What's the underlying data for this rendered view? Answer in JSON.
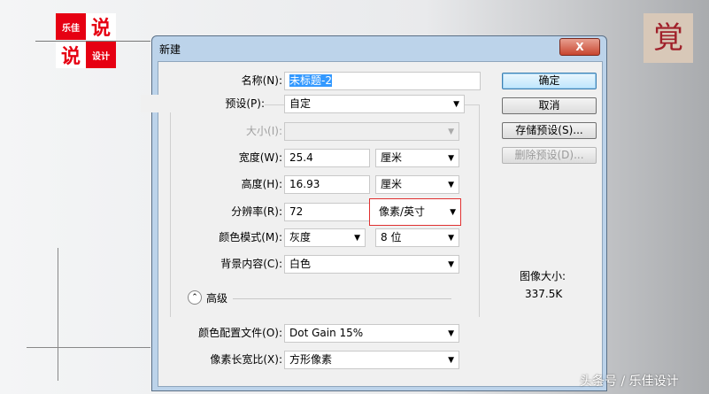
{
  "logo": {
    "text1": "乐佳",
    "text2": "说",
    "text3": "说",
    "text4": "设计",
    "seal": "覚"
  },
  "dialog": {
    "title": "新建",
    "close": "X",
    "name": {
      "label": "名称(N):",
      "value": "未标题-2"
    },
    "preset": {
      "label": "预设(P):",
      "value": "自定"
    },
    "size": {
      "label": "大小(I):",
      "value": ""
    },
    "width": {
      "label": "宽度(W):",
      "value": "25.4",
      "unit": "厘米"
    },
    "height": {
      "label": "高度(H):",
      "value": "16.93",
      "unit": "厘米"
    },
    "resolution": {
      "label": "分辨率(R):",
      "value": "72",
      "unit": "像素/英寸"
    },
    "color_mode": {
      "label": "颜色模式(M):",
      "value": "灰度",
      "bits": "8 位"
    },
    "background": {
      "label": "背景内容(C):",
      "value": "白色"
    },
    "advanced": {
      "label": "高级"
    },
    "color_profile": {
      "label": "颜色配置文件(O):",
      "value": "Dot Gain 15%"
    },
    "pixel_aspect": {
      "label": "像素长宽比(X):",
      "value": "方形像素"
    },
    "buttons": {
      "ok": "确定",
      "cancel": "取消",
      "save_preset": "存储预设(S)...",
      "delete_preset": "删除预设(D)..."
    },
    "image_size": {
      "label": "图像大小:",
      "value": "337.5K"
    }
  },
  "watermark": "头条号 / 乐佳设计",
  "colors": {
    "accent": "#e60012",
    "highlight": "#3399ff"
  }
}
